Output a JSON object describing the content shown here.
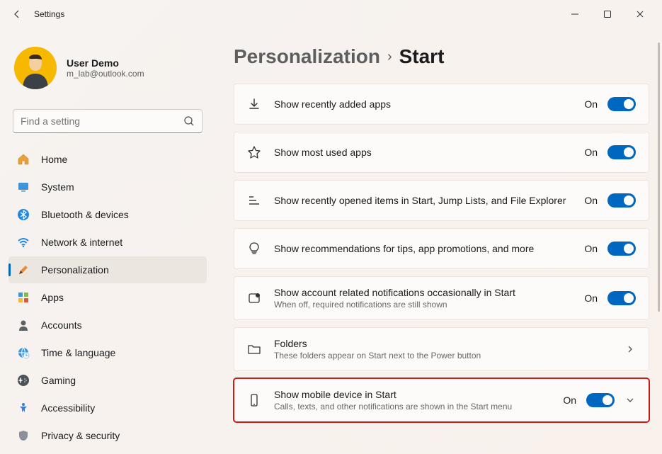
{
  "window": {
    "title": "Settings"
  },
  "user": {
    "name": "User Demo",
    "email": "m_lab@outlook.com"
  },
  "search": {
    "placeholder": "Find a setting"
  },
  "nav": {
    "home": "Home",
    "system": "System",
    "bluetooth": "Bluetooth & devices",
    "network": "Network & internet",
    "personalization": "Personalization",
    "apps": "Apps",
    "accounts": "Accounts",
    "time": "Time & language",
    "gaming": "Gaming",
    "accessibility": "Accessibility",
    "privacy": "Privacy & security"
  },
  "breadcrumb": {
    "parent": "Personalization",
    "current": "Start"
  },
  "settings": [
    {
      "icon": "download",
      "title": "Show recently added apps",
      "sub": "",
      "state": "On",
      "tail": "toggle"
    },
    {
      "icon": "star",
      "title": "Show most used apps",
      "sub": "",
      "state": "On",
      "tail": "toggle"
    },
    {
      "icon": "list",
      "title": "Show recently opened items in Start, Jump Lists, and File Explorer",
      "sub": "",
      "state": "On",
      "tail": "toggle"
    },
    {
      "icon": "bulb",
      "title": "Show recommendations for tips, app promotions, and more",
      "sub": "",
      "state": "On",
      "tail": "toggle"
    },
    {
      "icon": "badge",
      "title": "Show account related notifications occasionally in Start",
      "sub": "When off, required notifications are still shown",
      "state": "On",
      "tail": "toggle"
    },
    {
      "icon": "folder",
      "title": "Folders",
      "sub": "These folders appear on Start next to the Power button",
      "state": "",
      "tail": "chevron"
    },
    {
      "icon": "phone",
      "title": "Show mobile device in Start",
      "sub": "Calls, texts, and other notifications are shown in the Start menu",
      "state": "On",
      "tail": "toggle-expand",
      "highlighted": true
    }
  ]
}
